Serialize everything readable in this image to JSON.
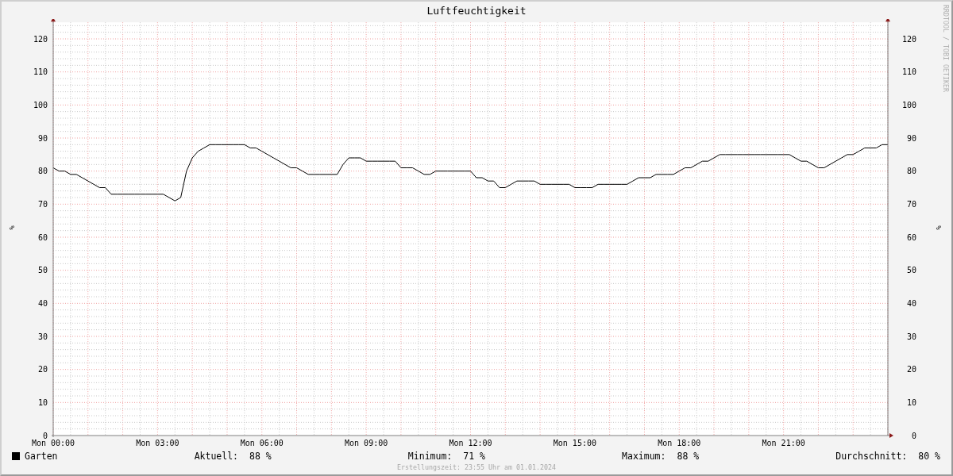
{
  "title": "Luftfeuchtigkeit",
  "credit": "RRDTOOL / TOBI OETIKER",
  "chart": {
    "right_ylabel": "%",
    "right_yticks": [
      "120",
      "110",
      "100",
      "90",
      "80",
      "70",
      "60",
      "50",
      "40",
      "30",
      "20",
      "10",
      "0"
    ],
    "chart_data": {
      "type": "line",
      "grid": true,
      "ylabel": "%",
      "ylim": [
        0,
        125
      ],
      "categories": [
        "Mon 00:00",
        null,
        null,
        null,
        null,
        null,
        null,
        null,
        null,
        null,
        null,
        null,
        null,
        null,
        null,
        null,
        null,
        null,
        "Mon 03:00",
        null,
        null,
        null,
        null,
        null,
        null,
        null,
        null,
        null,
        null,
        null,
        null,
        null,
        null,
        null,
        null,
        null,
        "Mon 06:00",
        null,
        null,
        null,
        null,
        null,
        null,
        null,
        null,
        null,
        null,
        null,
        null,
        null,
        null,
        null,
        null,
        null,
        "Mon 09:00",
        null,
        null,
        null,
        null,
        null,
        null,
        null,
        null,
        null,
        null,
        null,
        null,
        null,
        null,
        null,
        null,
        null,
        "Mon 12:00",
        null,
        null,
        null,
        null,
        null,
        null,
        null,
        null,
        null,
        null,
        null,
        null,
        null,
        null,
        null,
        null,
        null,
        "Mon 15:00",
        null,
        null,
        null,
        null,
        null,
        null,
        null,
        null,
        null,
        null,
        null,
        null,
        null,
        null,
        null,
        null,
        null,
        "Mon 18:00",
        null,
        null,
        null,
        null,
        null,
        null,
        null,
        null,
        null,
        null,
        null,
        null,
        null,
        null,
        null,
        null,
        null,
        "Mon 21:00",
        null,
        null,
        null,
        null,
        null,
        null,
        null,
        null,
        null,
        null,
        null,
        null,
        null,
        null,
        null,
        null,
        null,
        null
      ],
      "yticks": [
        0,
        10,
        20,
        30,
        40,
        50,
        60,
        70,
        80,
        90,
        100,
        110,
        120
      ],
      "series": [
        {
          "name": "Garten",
          "color": "#000000",
          "values": [
            81,
            80,
            80,
            79,
            79,
            78,
            77,
            76,
            75,
            75,
            73,
            73,
            73,
            73,
            73,
            73,
            73,
            73,
            73,
            73,
            72,
            71,
            72,
            80,
            84,
            86,
            87,
            88,
            88,
            88,
            88,
            88,
            88,
            88,
            87,
            87,
            86,
            85,
            84,
            83,
            82,
            81,
            81,
            80,
            79,
            79,
            79,
            79,
            79,
            79,
            82,
            84,
            84,
            84,
            83,
            83,
            83,
            83,
            83,
            83,
            81,
            81,
            81,
            80,
            79,
            79,
            80,
            80,
            80,
            80,
            80,
            80,
            80,
            78,
            78,
            77,
            77,
            75,
            75,
            76,
            77,
            77,
            77,
            77,
            76,
            76,
            76,
            76,
            76,
            76,
            75,
            75,
            75,
            75,
            76,
            76,
            76,
            76,
            76,
            76,
            77,
            78,
            78,
            78,
            79,
            79,
            79,
            79,
            80,
            81,
            81,
            82,
            83,
            83,
            84,
            85,
            85,
            85,
            85,
            85,
            85,
            85,
            85,
            85,
            85,
            85,
            85,
            85,
            84,
            83,
            83,
            82,
            81,
            81,
            82,
            83,
            84,
            85,
            85,
            86,
            87,
            87,
            87,
            88,
            88
          ]
        }
      ]
    }
  },
  "legend": {
    "stats": [
      {
        "label": "Aktuell:",
        "value": "88 %"
      },
      {
        "label": "Minimum:",
        "value": "71 %"
      },
      {
        "label": "Maximum:",
        "value": "88 %"
      },
      {
        "label": "Durchschnitt:",
        "value": "80 %"
      }
    ]
  },
  "footer": "Erstellungszeit: 23:55 Uhr am 01.01.2024"
}
